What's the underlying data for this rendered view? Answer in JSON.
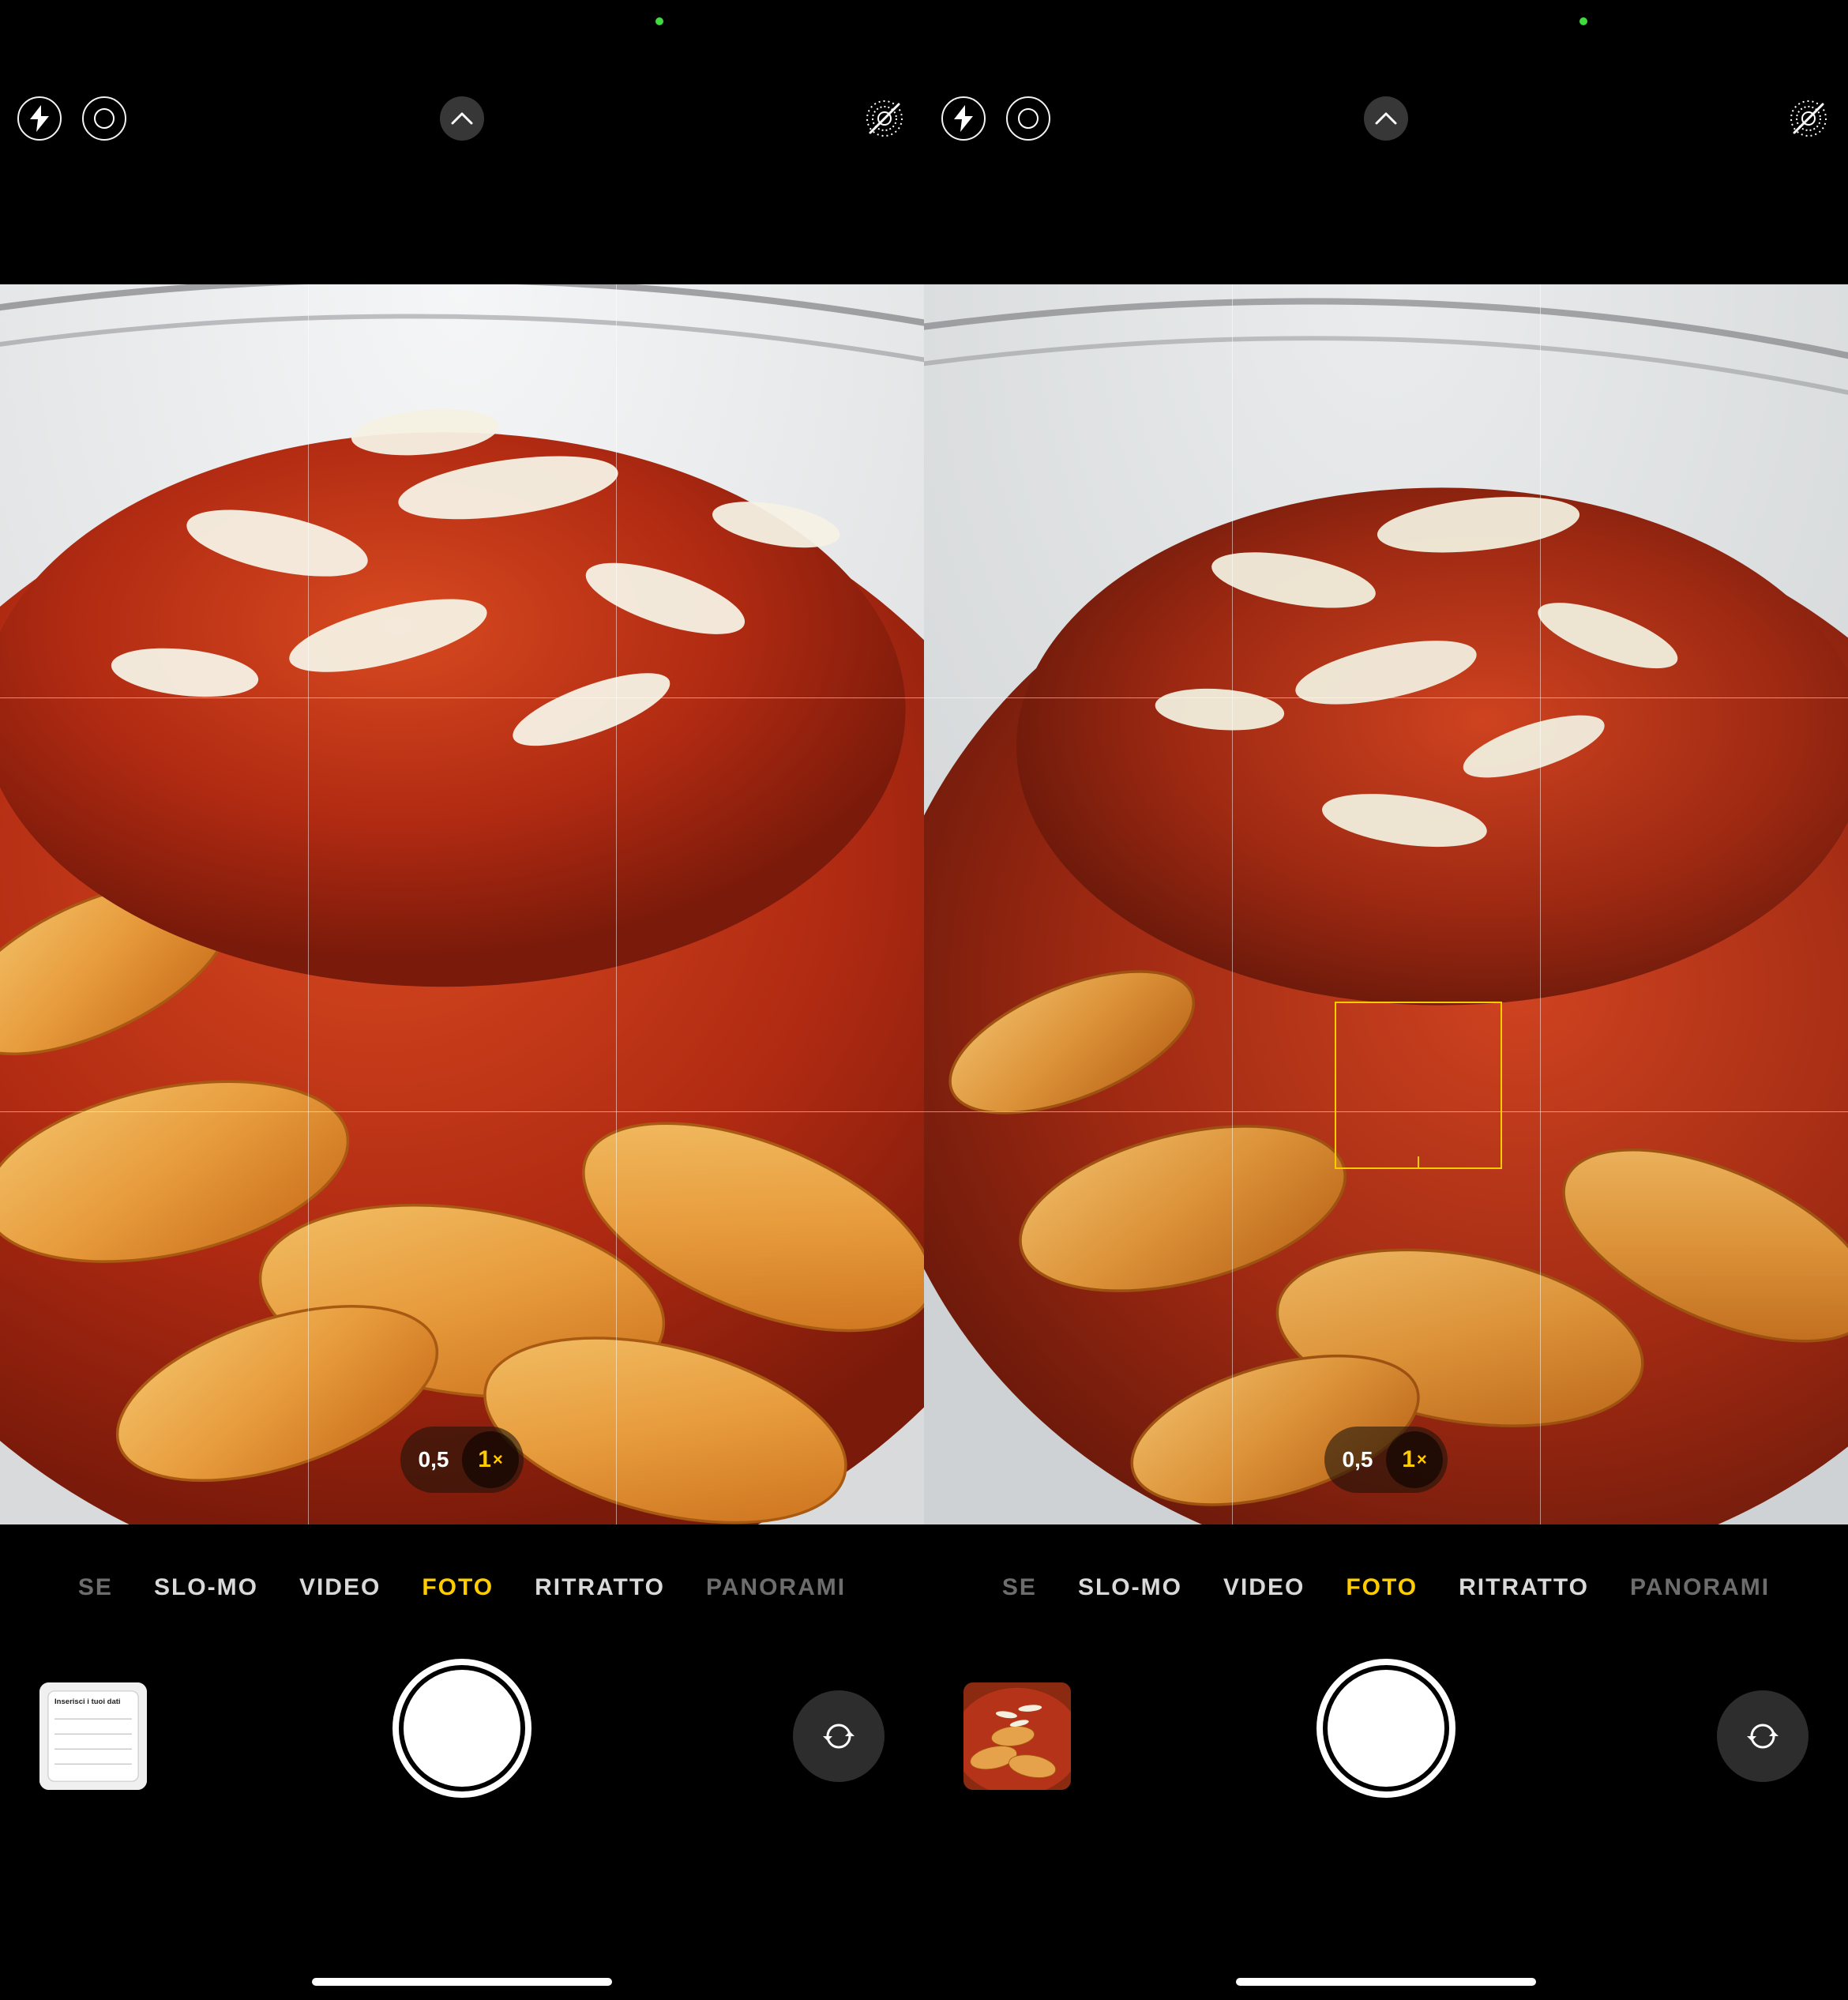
{
  "left": {
    "zoom": {
      "wide_label": "0,5",
      "sel_label": "1"
    },
    "modes": {
      "cut_l": "SE",
      "m1": "SLO-MO",
      "m2": "VIDEO",
      "m3": "FOTO",
      "m4": "RITRATTO",
      "cut_r": "PANORAMI"
    },
    "thumb": {
      "title": "Inserisci i tuoi dati"
    }
  },
  "right": {
    "zoom": {
      "wide_label": "0,5",
      "sel_label": "1"
    },
    "modes": {
      "cut_l": "SE",
      "m1": "SLO-MO",
      "m2": "VIDEO",
      "m3": "FOTO",
      "m4": "RITRATTO",
      "cut_r": "PANORAMI"
    }
  }
}
